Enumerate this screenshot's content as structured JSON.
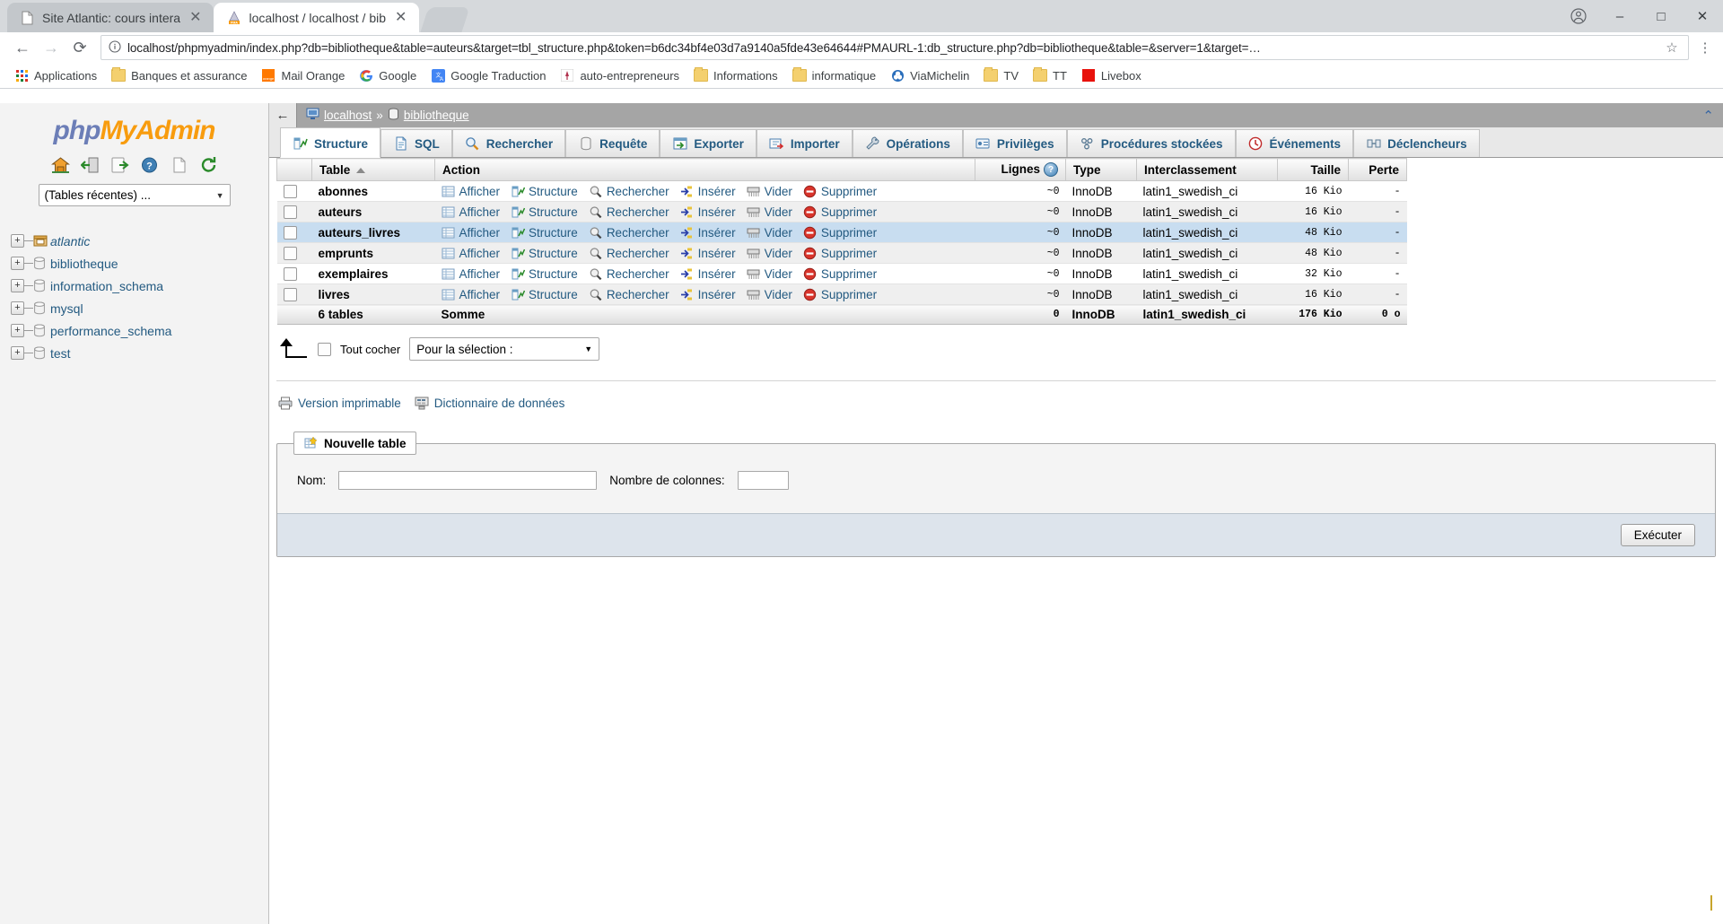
{
  "browser": {
    "tabs": [
      {
        "title": "Site Atlantic: cours intera",
        "favicon": "document-icon",
        "active": false
      },
      {
        "title": "localhost / localhost / bib",
        "favicon": "phpmyadmin-icon",
        "active": true
      }
    ],
    "window_controls": {
      "profile": "account-icon",
      "minimize": "–",
      "maximize": "□",
      "close": "✕"
    },
    "nav": {
      "back": "←",
      "forward": "→",
      "reload": "⟳"
    },
    "omnibox": {
      "info_icon": "info-circle-icon",
      "url": "localhost/phpmyadmin/index.php?db=bibliotheque&table=auteurs&target=tbl_structure.php&token=b6dc34bf4e03d7a9140a5fde43e64644#PMAURL-1:db_structure.php?db=bibliotheque&table=&server=1&target=…",
      "star": "☆",
      "menu": "⋮"
    },
    "bookmarks": [
      {
        "label": "Applications",
        "icon": "apps-grid-icon"
      },
      {
        "label": "Banques et assurance",
        "icon": "folder-icon"
      },
      {
        "label": "Mail Orange",
        "icon": "orange-icon"
      },
      {
        "label": "Google",
        "icon": "google-icon"
      },
      {
        "label": "Google Traduction",
        "icon": "translate-icon"
      },
      {
        "label": "auto-entrepreneurs",
        "icon": "site-icon"
      },
      {
        "label": "Informations",
        "icon": "folder-icon"
      },
      {
        "label": "informatique",
        "icon": "folder-icon"
      },
      {
        "label": "ViaMichelin",
        "icon": "michelin-icon"
      },
      {
        "label": "TV",
        "icon": "folder-icon"
      },
      {
        "label": "TT",
        "icon": "folder-icon"
      },
      {
        "label": "Livebox",
        "icon": "livebox-icon"
      }
    ]
  },
  "navi": {
    "logo": {
      "part1": "php",
      "part2": "MyAdmin"
    },
    "icons": [
      {
        "name": "home-icon"
      },
      {
        "name": "logout-icon"
      },
      {
        "name": "sql-query-icon"
      },
      {
        "name": "help-icon"
      },
      {
        "name": "docs-icon"
      },
      {
        "name": "reload-icon"
      }
    ],
    "recent_select": {
      "value": "(Tables récentes) ...",
      "arrow": "▼"
    },
    "databases": [
      {
        "label": "atlantic",
        "italic": true,
        "icon": "db-highlight-icon"
      },
      {
        "label": "bibliotheque",
        "italic": false,
        "icon": "db-icon"
      },
      {
        "label": "information_schema",
        "italic": false,
        "icon": "db-icon"
      },
      {
        "label": "mysql",
        "italic": false,
        "icon": "db-icon"
      },
      {
        "label": "performance_schema",
        "italic": false,
        "icon": "db-icon"
      },
      {
        "label": "test",
        "italic": false,
        "icon": "db-icon"
      }
    ]
  },
  "breadcrumb": {
    "back": "←",
    "server": "localhost",
    "separator": "»",
    "database": "bibliotheque",
    "collapse": "⌃"
  },
  "tabs": [
    {
      "label": "Structure",
      "icon": "structure-icon",
      "active": true
    },
    {
      "label": "SQL",
      "icon": "sql-icon",
      "active": false
    },
    {
      "label": "Rechercher",
      "icon": "search-icon",
      "active": false
    },
    {
      "label": "Requête",
      "icon": "query-icon",
      "active": false
    },
    {
      "label": "Exporter",
      "icon": "export-icon",
      "active": false
    },
    {
      "label": "Importer",
      "icon": "import-icon",
      "active": false
    },
    {
      "label": "Opérations",
      "icon": "operations-icon",
      "active": false
    },
    {
      "label": "Privilèges",
      "icon": "privileges-icon",
      "active": false
    },
    {
      "label": "Procédures stockées",
      "icon": "routines-icon",
      "active": false
    },
    {
      "label": "Événements",
      "icon": "events-icon",
      "active": false
    },
    {
      "label": "Déclencheurs",
      "icon": "triggers-icon",
      "active": false
    }
  ],
  "table_list": {
    "headers": {
      "table": "Table",
      "action": "Action",
      "rows": "Lignes",
      "type": "Type",
      "collation": "Interclassement",
      "size": "Taille",
      "overhead": "Perte"
    },
    "actions": [
      {
        "label": "Afficher",
        "icon": "browse-icon"
      },
      {
        "label": "Structure",
        "icon": "structure-icon"
      },
      {
        "label": "Rechercher",
        "icon": "search-icon"
      },
      {
        "label": "Insérer",
        "icon": "insert-icon"
      },
      {
        "label": "Vider",
        "icon": "empty-icon"
      },
      {
        "label": "Supprimer",
        "icon": "drop-icon"
      }
    ],
    "rows": [
      {
        "name": "abonnes",
        "rows": "~0",
        "type": "InnoDB",
        "collation": "latin1_swedish_ci",
        "size": "16 Kio",
        "overhead": "-"
      },
      {
        "name": "auteurs",
        "rows": "~0",
        "type": "InnoDB",
        "collation": "latin1_swedish_ci",
        "size": "16 Kio",
        "overhead": "-"
      },
      {
        "name": "auteurs_livres",
        "rows": "~0",
        "type": "InnoDB",
        "collation": "latin1_swedish_ci",
        "size": "48 Kio",
        "overhead": "-"
      },
      {
        "name": "emprunts",
        "rows": "~0",
        "type": "InnoDB",
        "collation": "latin1_swedish_ci",
        "size": "48 Kio",
        "overhead": "-"
      },
      {
        "name": "exemplaires",
        "rows": "~0",
        "type": "InnoDB",
        "collation": "latin1_swedish_ci",
        "size": "32 Kio",
        "overhead": "-"
      },
      {
        "name": "livres",
        "rows": "~0",
        "type": "InnoDB",
        "collation": "latin1_swedish_ci",
        "size": "16 Kio",
        "overhead": "-"
      }
    ],
    "summary": {
      "count": "6 tables",
      "action": "Somme",
      "rows": "0",
      "type": "InnoDB",
      "collation": "latin1_swedish_ci",
      "size": "176 Kio",
      "overhead": "0 o"
    },
    "sort_indicator": "▲",
    "help_icon": "help-circle-icon"
  },
  "bottom": {
    "check_all": "Tout cocher",
    "with_selected": {
      "value": "Pour la sélection :",
      "arrow": "▼"
    },
    "printable": {
      "label": "Version imprimable",
      "icon": "print-icon"
    },
    "data_dict": {
      "label": "Dictionnaire de données",
      "icon": "dictionary-icon"
    }
  },
  "new_table": {
    "legend": "Nouvelle table",
    "legend_icon": "new-table-icon",
    "name_label": "Nom:",
    "name_value": "",
    "columns_label": "Nombre de colonnes:",
    "columns_value": "",
    "submit": "Exécuter"
  },
  "colors": {
    "pma_blue": "#235a81",
    "pma_orange": "#f89c0e",
    "pma_purple": "#6c7eb7",
    "highlight_row": "#c8ddf0",
    "footer_bg": "#dde4ec"
  }
}
